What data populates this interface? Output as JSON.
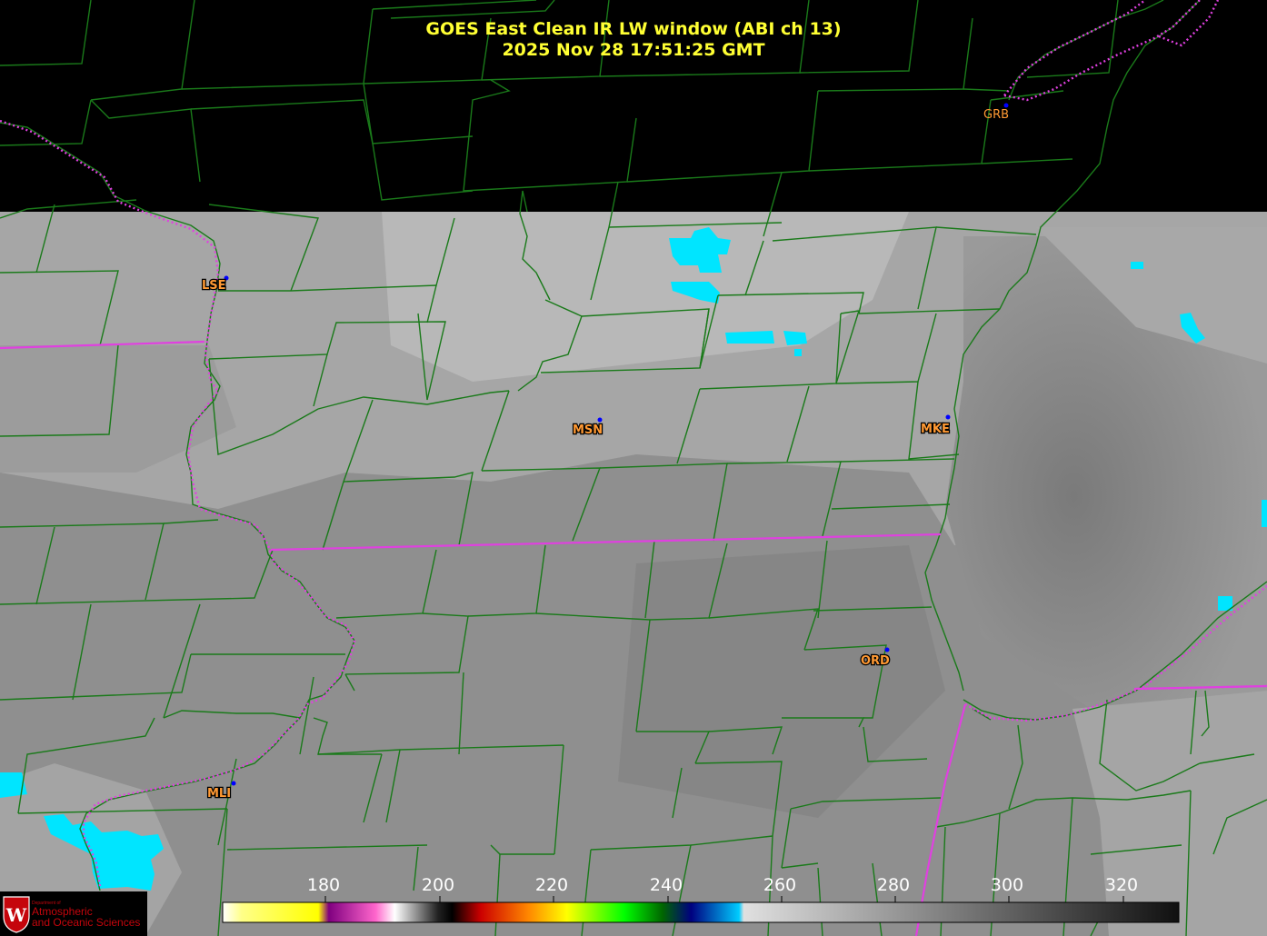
{
  "title": {
    "line1": "GOES East Clean IR LW window (ABI ch 13)",
    "line2": "2025 Nov 28  17:51:25 GMT"
  },
  "stations": [
    {
      "id": "GRB",
      "label": "GRB"
    },
    {
      "id": "LSE",
      "label": "LSE"
    },
    {
      "id": "MSN",
      "label": "MSN"
    },
    {
      "id": "MKE",
      "label": "MKE"
    },
    {
      "id": "ORD",
      "label": "ORD"
    },
    {
      "id": "MLI",
      "label": "MLI"
    }
  ],
  "colorbar": {
    "ticks": [
      "180",
      "200",
      "220",
      "240",
      "260",
      "280",
      "300",
      "320"
    ]
  },
  "logo": {
    "dept": "Department of",
    "line1": "Atmospheric",
    "line2": "and Oceanic Sciences"
  },
  "colors": {
    "county_lines": "#1a7a1a",
    "state_lines": "#e040e0",
    "title": "#ffff33",
    "station_label": "#ff9933",
    "station_dot": "#0000ff",
    "cold_cloud": "#00e5ff"
  }
}
